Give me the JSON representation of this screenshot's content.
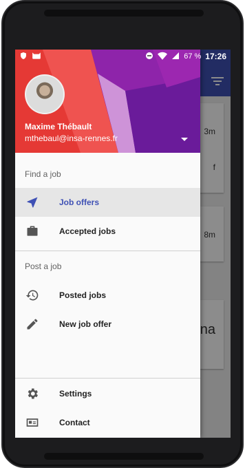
{
  "status_bar": {
    "battery": "67 %",
    "time": "17:26"
  },
  "drawer": {
    "user": {
      "name": "Maxime Thébault",
      "email": "mthebaul@insa-rennes.fr"
    },
    "sections": [
      {
        "header": "Find a job",
        "items": [
          {
            "label": "Job offers",
            "icon": "navigation-arrow-icon",
            "active": true
          },
          {
            "label": "Accepted jobs",
            "icon": "briefcase-icon",
            "active": false
          }
        ]
      },
      {
        "header": "Post a job",
        "items": [
          {
            "label": "Posted jobs",
            "icon": "history-icon",
            "active": false
          },
          {
            "label": "New job offer",
            "icon": "pencil-icon",
            "active": false
          }
        ]
      },
      {
        "header": "",
        "items": [
          {
            "label": "Settings",
            "icon": "gear-icon",
            "active": false
          },
          {
            "label": "Contact",
            "icon": "contact-card-icon",
            "active": false
          }
        ]
      }
    ]
  },
  "background": {
    "card_snippets": [
      "3m",
      "f",
      "8m",
      "na"
    ]
  },
  "colors": {
    "accent": "#3f51b5",
    "header_purple": "#6a1b9a",
    "header_red": "#e53935"
  }
}
